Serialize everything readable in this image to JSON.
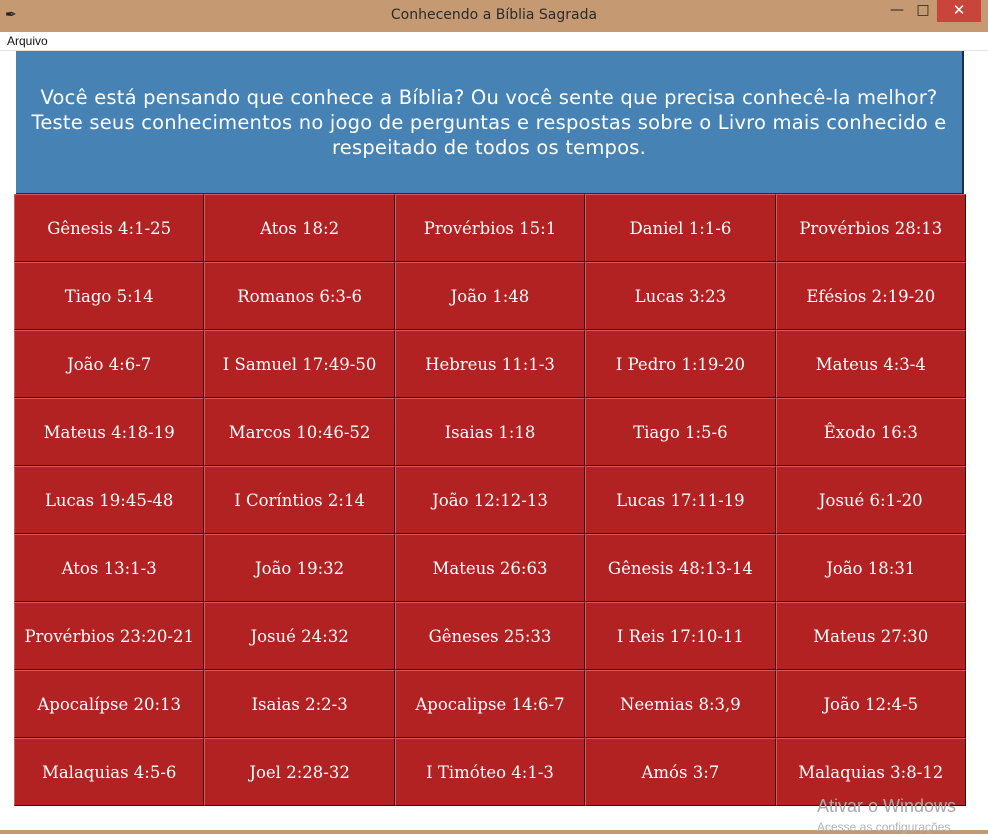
{
  "window": {
    "title": "Conhecendo a Bíblia Sagrada",
    "icon": "feather-icon",
    "minimize_glyph": "—",
    "maximize_glyph": "□",
    "close_glyph": "✕"
  },
  "menu": {
    "file_label": "Arquivo"
  },
  "header": {
    "text": "Você está pensando que conhece a Bíblia? Ou você sente que precisa conhecê-la melhor? Teste seus conhecimentos no jogo de perguntas e respostas sobre o Livro mais conhecido e respeitado de todos os tempos."
  },
  "grid": {
    "rows": [
      [
        "Gênesis 4:1-25",
        "Atos 18:2",
        "Provérbios 15:1",
        "Daniel 1:1-6",
        "Provérbios 28:13"
      ],
      [
        "Tiago 5:14",
        "Romanos 6:3-6",
        "João 1:48",
        "Lucas 3:23",
        "Efésios 2:19-20"
      ],
      [
        "João 4:6-7",
        "I Samuel 17:49-50",
        "Hebreus 11:1-3",
        "I Pedro 1:19-20",
        "Mateus 4:3-4"
      ],
      [
        "Mateus 4:18-19",
        "Marcos 10:46-52",
        "Isaias 1:18",
        "Tiago 1:5-6",
        "Êxodo 16:3"
      ],
      [
        "Lucas 19:45-48",
        "I Coríntios 2:14",
        "João 12:12-13",
        "Lucas 17:11-19",
        "Josué 6:1-20"
      ],
      [
        "Atos 13:1-3",
        "João 19:32",
        "Mateus 26:63",
        "Gênesis 48:13-14",
        "João 18:31"
      ],
      [
        "Provérbios 23:20-21",
        "Josué 24:32",
        "Gêneses 25:33",
        "I Reis 17:10-11",
        "Mateus 27:30"
      ],
      [
        "Apocalípse 20:13",
        "Isaias 2:2-3",
        "Apocalipse 14:6-7",
        "Neemias 8:3,9",
        "João 12:4-5"
      ],
      [
        "Malaquias 4:5-6",
        "Joel 2:28-32",
        "I Timóteo 4:1-3",
        "Amós 3:7",
        "Malaquias 3:8-12"
      ]
    ]
  },
  "watermark": {
    "line1": "Ativar o Windows",
    "line2": "Acesse as configurações"
  },
  "colors": {
    "titlebar": "#c59a72",
    "header_bg": "#4682b4",
    "cell_bg": "#b22222",
    "text_light": "#ffffff"
  }
}
